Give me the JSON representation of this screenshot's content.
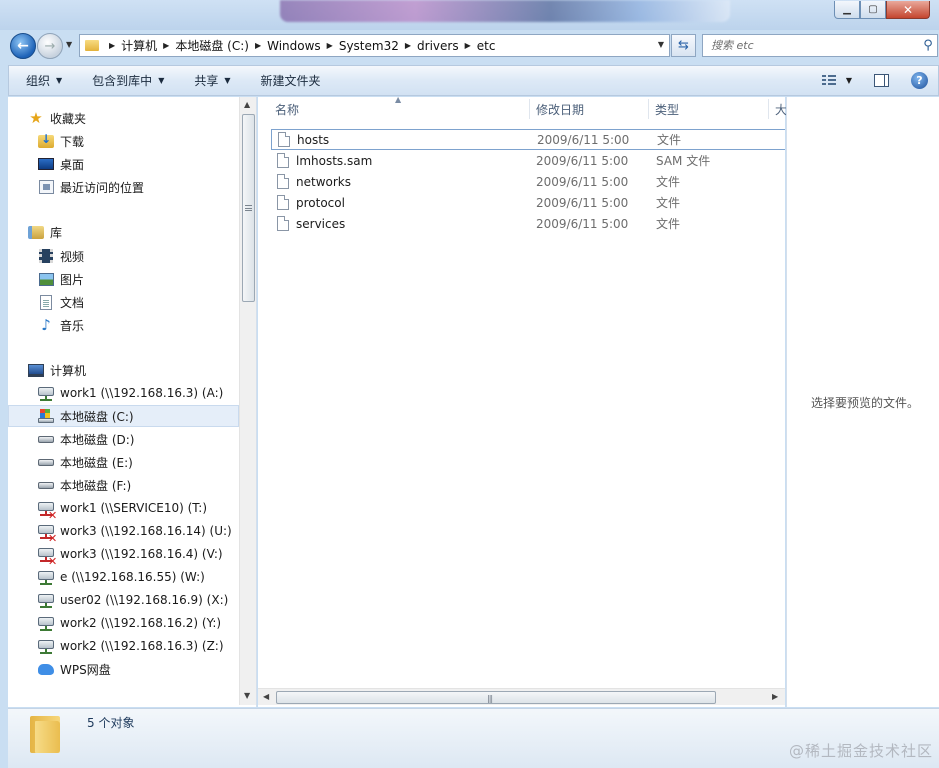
{
  "window": {
    "minimize_glyph": "▁",
    "maximize_glyph": "▢",
    "close_glyph": "✕"
  },
  "address": {
    "crumbs": [
      "计算机",
      "本地磁盘 (C:)",
      "Windows",
      "System32",
      "drivers",
      "etc"
    ]
  },
  "search": {
    "placeholder": "搜索 etc"
  },
  "toolbar": {
    "organize": "组织",
    "include_in_library": "包含到库中",
    "share": "共享",
    "new_folder": "新建文件夹"
  },
  "nav": {
    "favorites": {
      "label": "收藏夹",
      "items": [
        {
          "label": "下载",
          "icon": "download-folder-icon"
        },
        {
          "label": "桌面",
          "icon": "desktop-icon"
        },
        {
          "label": "最近访问的位置",
          "icon": "recent-places-icon"
        }
      ]
    },
    "libraries": {
      "label": "库",
      "items": [
        {
          "label": "视频",
          "icon": "video-icon"
        },
        {
          "label": "图片",
          "icon": "picture-icon"
        },
        {
          "label": "文档",
          "icon": "document-icon"
        },
        {
          "label": "音乐",
          "icon": "music-icon"
        }
      ]
    },
    "computer": {
      "label": "计算机",
      "items": [
        {
          "label": "work1 (\\\\192.168.16.3) (A:)",
          "icon": "network-drive-icon",
          "state": "connected"
        },
        {
          "label": "本地磁盘 (C:)",
          "icon": "system-drive-icon",
          "state": "selected"
        },
        {
          "label": "本地磁盘 (D:)",
          "icon": "hard-drive-icon"
        },
        {
          "label": "本地磁盘 (E:)",
          "icon": "hard-drive-icon"
        },
        {
          "label": "本地磁盘 (F:)",
          "icon": "hard-drive-icon"
        },
        {
          "label": "work1 (\\\\SERVICE10) (T:)",
          "icon": "network-drive-icon",
          "state": "disconnected"
        },
        {
          "label": "work3 (\\\\192.168.16.14) (U:)",
          "icon": "network-drive-icon",
          "state": "disconnected"
        },
        {
          "label": "work3 (\\\\192.168.16.4) (V:)",
          "icon": "network-drive-icon",
          "state": "disconnected"
        },
        {
          "label": "e (\\\\192.168.16.55) (W:)",
          "icon": "network-drive-icon",
          "state": "connected"
        },
        {
          "label": "user02 (\\\\192.168.16.9) (X:)",
          "icon": "network-drive-icon",
          "state": "connected"
        },
        {
          "label": "work2 (\\\\192.168.16.2) (Y:)",
          "icon": "network-drive-icon",
          "state": "connected"
        },
        {
          "label": "work2 (\\\\192.168.16.3) (Z:)",
          "icon": "network-drive-icon",
          "state": "connected"
        },
        {
          "label": "WPS网盘",
          "icon": "cloud-icon"
        }
      ]
    }
  },
  "files": {
    "columns": [
      "名称",
      "修改日期",
      "类型",
      "大"
    ],
    "rows": [
      {
        "name": "hosts",
        "modified": "2009/6/11 5:00",
        "type": "文件"
      },
      {
        "name": "lmhosts.sam",
        "modified": "2009/6/11 5:00",
        "type": "SAM 文件"
      },
      {
        "name": "networks",
        "modified": "2009/6/11 5:00",
        "type": "文件"
      },
      {
        "name": "protocol",
        "modified": "2009/6/11 5:00",
        "type": "文件"
      },
      {
        "name": "services",
        "modified": "2009/6/11 5:00",
        "type": "文件"
      }
    ]
  },
  "preview": {
    "message": "选择要预览的文件。"
  },
  "details": {
    "count": "5 个对象"
  },
  "watermark": "@稀土掘金技术社区",
  "colors": {
    "accent": "#1d62b7",
    "selected_bg": "#e5eef9",
    "error": "#d12222"
  }
}
